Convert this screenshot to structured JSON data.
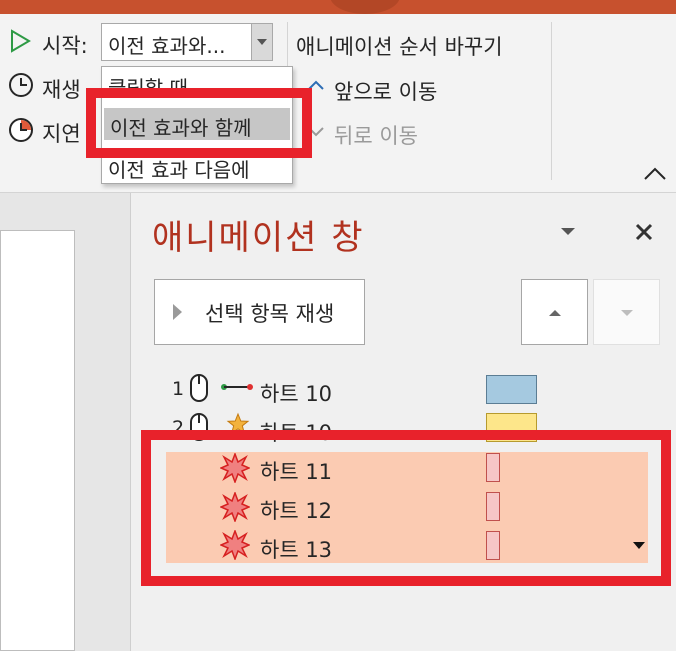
{
  "ribbon": {
    "start_label": "시작:",
    "start_value": "이전 효과와...",
    "duration_label": "재생",
    "delay_label": "지연",
    "reorder_title": "애니메이션 순서 바꾸기",
    "move_earlier": "앞으로 이동",
    "move_later": "뒤로 이동",
    "start_options": [
      "클릭할 때",
      "이전 효과와 함께",
      "이전 효과 다음에"
    ],
    "selected_option_index": 1
  },
  "pane": {
    "title": "애니메이션 창",
    "play_button": "선택 항목 재생",
    "items": [
      {
        "number": "1",
        "name": "하트 10",
        "trigger": "mouse",
        "effect": "motion-path",
        "bar_color": "#a5c9e0"
      },
      {
        "number": "2",
        "name": "하트 10",
        "trigger": "mouse",
        "effect": "emphasis-star",
        "bar_color": "#fde68a"
      },
      {
        "number": "",
        "name": "하트 11",
        "trigger": "",
        "effect": "exit-burst",
        "bar_color": "#f6c6c6"
      },
      {
        "number": "",
        "name": "하트 12",
        "trigger": "",
        "effect": "exit-burst",
        "bar_color": "#f6c6c6"
      },
      {
        "number": "",
        "name": "하트 13",
        "trigger": "",
        "effect": "exit-burst",
        "bar_color": "#f6c6c6"
      }
    ]
  },
  "colors": {
    "accent_red": "#e8222b",
    "title_red": "#b1321f",
    "selected_row_fill": "#fbcbb2",
    "ribbon_top": "#c7512e"
  }
}
